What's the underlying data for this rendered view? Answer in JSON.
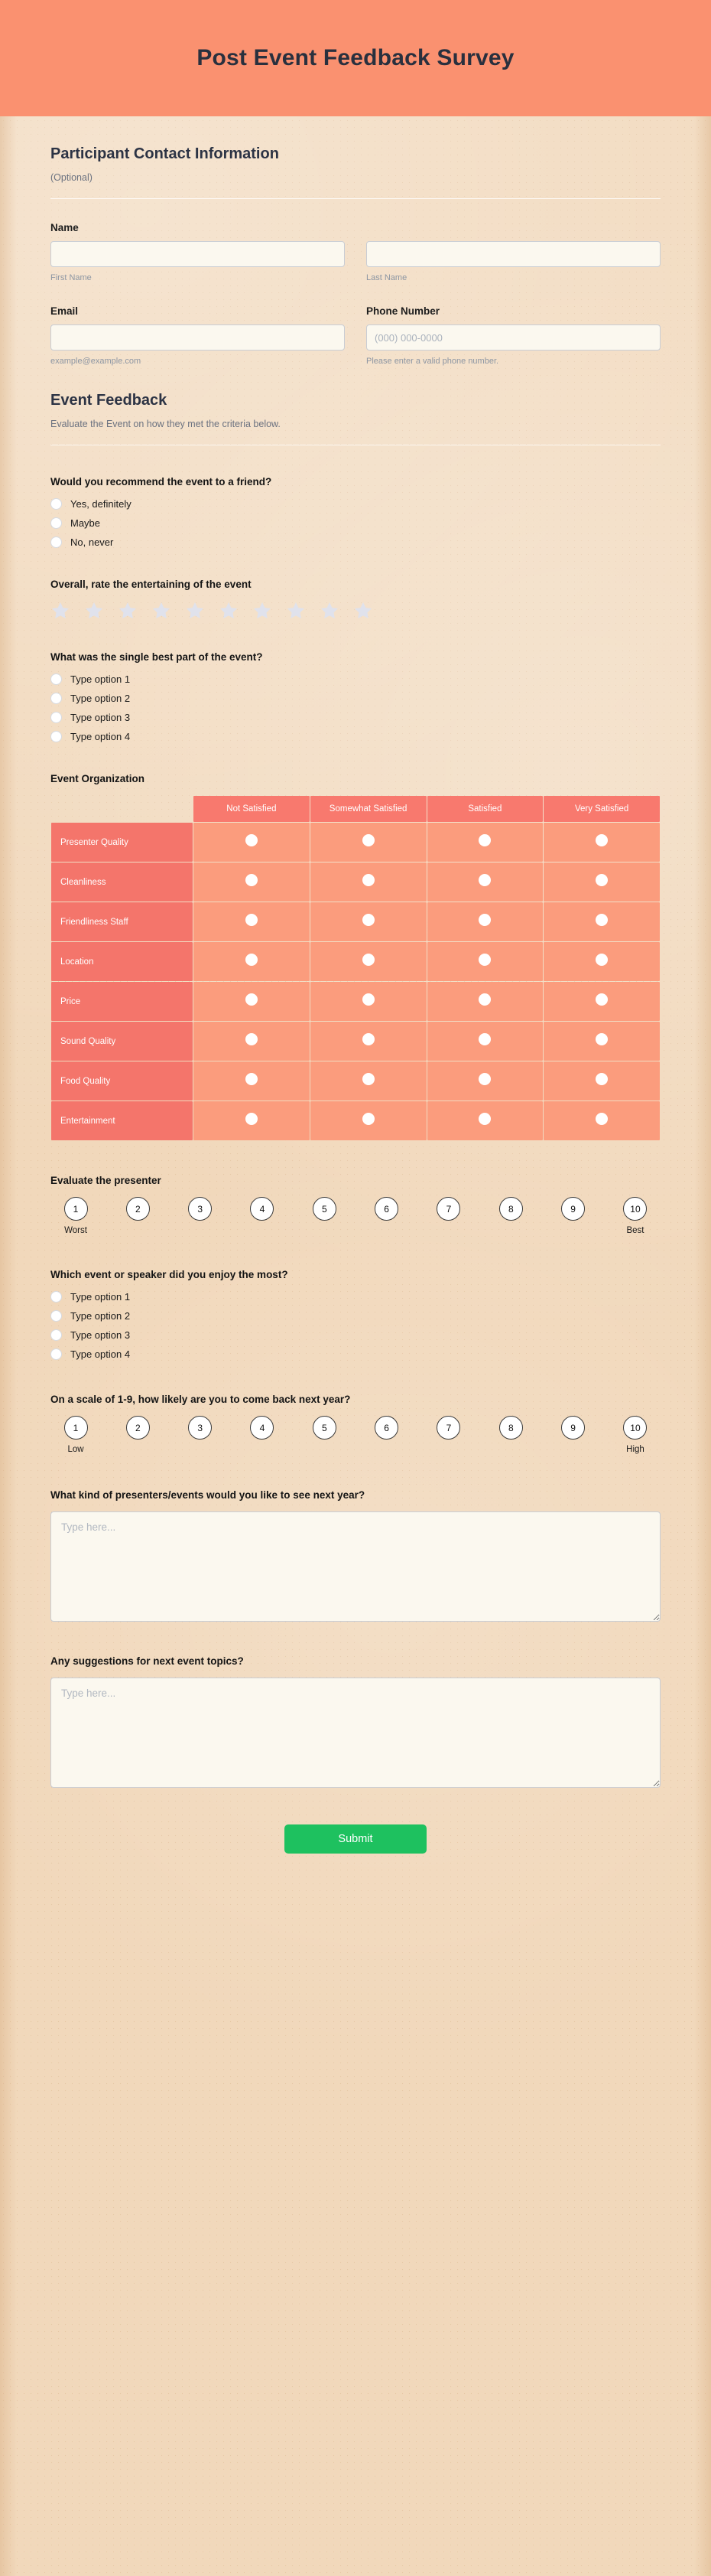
{
  "header": {
    "title": "Post Event Feedback Survey",
    "bg_color": "#fa9170",
    "text_color": "#29303e"
  },
  "contact_section": {
    "title": "Participant Contact Information",
    "subtitle": "(Optional)",
    "name_label": "Name",
    "first_name": {
      "value": "",
      "placeholder": "",
      "hint": "First Name"
    },
    "last_name": {
      "value": "",
      "placeholder": "",
      "hint": "Last Name"
    },
    "email_label": "Email",
    "email": {
      "value": "",
      "placeholder": "",
      "hint": "example@example.com"
    },
    "phone_label": "Phone Number",
    "phone": {
      "value": "",
      "placeholder": "(000) 000-0000",
      "hint": "Please enter a valid phone number."
    }
  },
  "feedback_section": {
    "title": "Event Feedback",
    "subtitle": "Evaluate the Event on how they met the criteria below."
  },
  "q_recommend": {
    "label": "Would you recommend the event to a friend?",
    "options": [
      "Yes, definitely",
      "Maybe",
      "No, never"
    ]
  },
  "q_entertaining": {
    "label": "Overall, rate the entertaining of the event",
    "star_count": 10,
    "stars_filled": 0,
    "star_color": "#e0e2ec"
  },
  "q_best_part": {
    "label": "What was the single best part of the event?",
    "options": [
      "Type option 1",
      "Type option 2",
      "Type option 3",
      "Type option 4"
    ]
  },
  "matrix": {
    "label": "Event Organization",
    "columns": [
      "Not Satisfied",
      "Somewhat Satisfied",
      "Satisfied",
      "Very Satisfied"
    ],
    "rows": [
      "Presenter Quality",
      "Cleanliness",
      "Friendliness Staff",
      "Location",
      "Price",
      "Sound Quality",
      "Food Quality",
      "Entertainment"
    ],
    "header_color": "#f8796e",
    "row_header_color": "#f4756b",
    "cell_color": "#fb9c7d"
  },
  "q_presenter_scale": {
    "label": "Evaluate the presenter",
    "values": [
      "1",
      "2",
      "3",
      "4",
      "5",
      "6",
      "7",
      "8",
      "9",
      "10"
    ],
    "low_label": "Worst",
    "high_label": "Best"
  },
  "q_enjoy_most": {
    "label": "Which event or speaker did you enjoy the most?",
    "options": [
      "Type option 1",
      "Type option 2",
      "Type option 3",
      "Type option 4"
    ]
  },
  "q_comeback_scale": {
    "label": "On a scale of 1-9, how likely are you to come back next year?",
    "values": [
      "1",
      "2",
      "3",
      "4",
      "5",
      "6",
      "7",
      "8",
      "9",
      "10"
    ],
    "low_label": "Low",
    "high_label": "High"
  },
  "q_presenters_next_year": {
    "label": "What kind of presenters/events would you like to see next year?",
    "value": "",
    "placeholder": "Type here..."
  },
  "q_suggestions": {
    "label": "Any suggestions for next event topics?",
    "value": "",
    "placeholder": "Type here..."
  },
  "submit": {
    "label": "Submit",
    "color": "#1ec15f"
  }
}
